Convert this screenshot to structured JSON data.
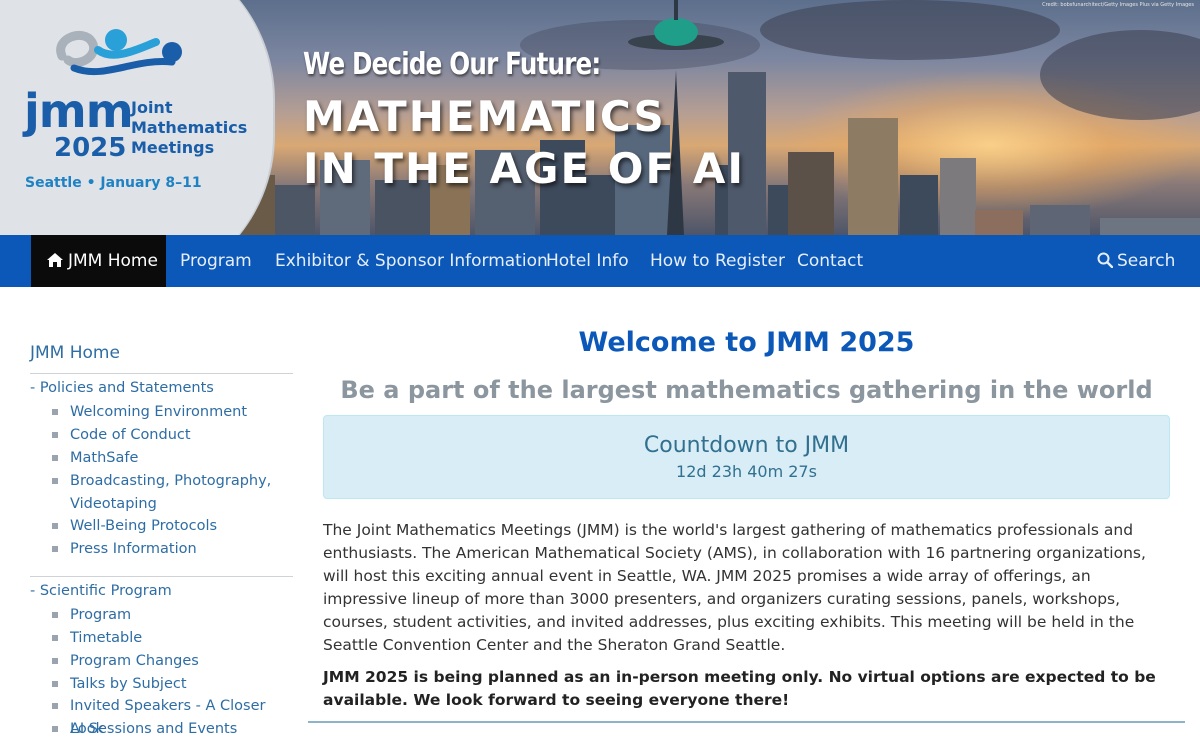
{
  "banner": {
    "logo": {
      "acronym": "jmm",
      "year": "2025",
      "name_lines": [
        "Joint",
        "Mathematics",
        "Meetings"
      ],
      "place": "Seattle",
      "dates": "January 8–11"
    },
    "tagline_1": "We Decide Our Future:",
    "tagline_2": "MATHEMATICS",
    "tagline_3": "IN THE AGE OF AI",
    "photo_credit": "Credit: bobsfunarchitect/Getty Images Plus via Getty Images"
  },
  "nav": {
    "items": [
      {
        "label": "JMM Home",
        "icon": "home-icon",
        "active": true
      },
      {
        "label": "Program"
      },
      {
        "label": "Exhibitor & Sponsor Information"
      },
      {
        "label": "Hotel Info"
      },
      {
        "label": "How to Register"
      },
      {
        "label": "Contact"
      }
    ],
    "search": {
      "label": "Search",
      "icon": "search-icon"
    }
  },
  "sidebar": {
    "home": "JMM Home",
    "sections": [
      {
        "title": "- Policies and Statements",
        "items": [
          "Welcoming Environment",
          "Code of Conduct",
          "MathSafe",
          "Broadcasting, Photography, Videotaping",
          "Well-Being Protocols",
          "Press Information"
        ]
      },
      {
        "title": "- Scientific Program",
        "items": [
          "Program",
          "Timetable",
          "Program Changes",
          "Talks by Subject",
          "Invited Speakers - A Closer Look",
          "AI Sessions and Events"
        ]
      }
    ]
  },
  "main": {
    "title": "Welcome to JMM 2025",
    "subtitle": "Be a part of the largest mathematics gathering in the world",
    "countdown": {
      "title": "Countdown to JMM",
      "time": "12d 23h 40m 27s"
    },
    "intro": "The Joint Mathematics Meetings (JMM) is the world's largest gathering of mathematics professionals and enthusiasts. The American Mathematical Society (AMS), in collaboration with 16 partnering organizations, will host this exciting annual event in Seattle, WA. JMM 2025 promises a wide array of offerings, an impressive lineup of more than 3000 presenters, and organizers curating sessions, panels, workshops, courses, student activities, and invited addresses, plus exciting exhibits. This meeting will be held in the Seattle Convention Center and the Sheraton Grand Seattle.",
    "notice": "JMM 2025 is being planned as an in-person meeting only. No virtual options are expected to be available. We look forward to seeing everyone there!"
  },
  "colors": {
    "nav_bg": "#0b58b8",
    "nav_active_bg": "#0b0b0b",
    "link": "#2e6da4",
    "title": "#0b58b8",
    "countdown_bg": "#d9edf7",
    "countdown_text": "#31708f"
  }
}
